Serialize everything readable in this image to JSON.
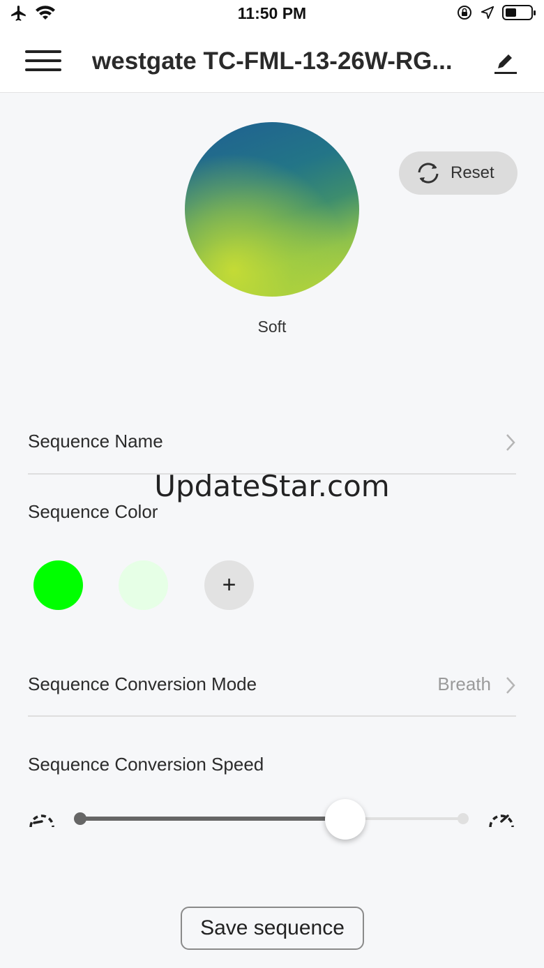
{
  "status_bar": {
    "time": "11:50 PM",
    "left_icons": [
      "airplane-icon",
      "wifi-icon"
    ],
    "right_icons": [
      "orientation-lock-icon",
      "location-icon",
      "battery-icon"
    ]
  },
  "nav": {
    "title": "westgate TC-FML-13-26W-RG...",
    "menu_icon": "hamburger-menu-icon",
    "edit_icon": "pencil-edit-icon"
  },
  "preview": {
    "label": "Soft",
    "colors": [
      "#1f5f92",
      "#3d8d6e",
      "#c4da36"
    ]
  },
  "reset_button": {
    "label": "Reset",
    "icon": "refresh-icon"
  },
  "sequence_name": {
    "label": "Sequence Name",
    "value": ""
  },
  "watermark": "UpdateStar.com",
  "sequence_color": {
    "label": "Sequence Color",
    "swatches": [
      "#00ff00",
      "#e6ffe6"
    ],
    "add_label": "+"
  },
  "conversion_mode": {
    "label": "Sequence Conversion Mode",
    "value": "Breath"
  },
  "conversion_speed": {
    "label": "Sequence Conversion Speed",
    "value_fraction": 0.69,
    "min_icon": "slow-speedometer-icon",
    "max_icon": "fast-speedometer-icon"
  },
  "save_button": {
    "label": "Save sequence"
  }
}
